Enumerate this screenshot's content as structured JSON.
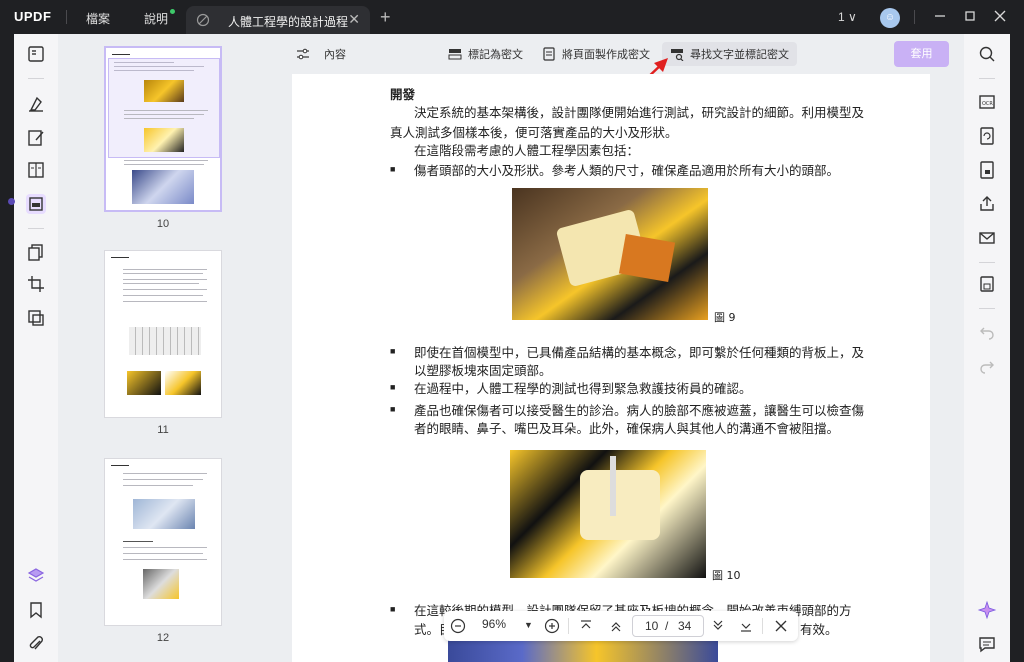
{
  "app": {
    "logo": "UPDF",
    "menu_file": "檔案",
    "menu_help": "說明",
    "tab_title": "人體工程學的設計過程",
    "page_counter": "1"
  },
  "toolbar": {
    "contents": "內容",
    "mark_as_image": "標記為密文",
    "page_to_image": "將頁面製作成密文",
    "find_and_mark": "尋找文字並標記密文",
    "apply": "套用"
  },
  "thumbnails": [
    {
      "page": "10",
      "selected": true
    },
    {
      "page": "11",
      "selected": false
    },
    {
      "page": "12",
      "selected": false
    }
  ],
  "document": {
    "heading": "開發",
    "p1_line1": "決定系統的基本架構後，設計團隊便開始進行測試，研究設計的細節。利用模型及",
    "p1_line2": "真人測試多個樣本後，便可落實產品的大小及形狀。",
    "p2": "在這階段需考慮的人體工程學因素包括：",
    "b1": "傷者頭部的大小及形狀。參考人類的尺寸，確保產品適用於所有大小的頭部。",
    "fig9": "圖 9",
    "b2_line1": "即使在首個模型中，已具備產品結構的基本概念，即可繫於任何種類的背板上，及",
    "b2_line2": "以塑膠板塊來固定頭部。",
    "b3": "在過程中，人體工程學的測試也得到緊急救護技術員的確認。",
    "b4_line1": "產品也確保傷者可以接受醫生的診治。病人的臉部不應被遮蓋，讓醫生可以檢查傷",
    "b4_line2": "者的眼睛、鼻子、嘴巴及耳朵。此外，確保病人與其他人的溝通不會被阻擋。",
    "fig10": "圖 10",
    "b5_line1": "在這較後期的模型，設計團隊保留了基座及板塊的概念，開始改善束縛頭部的方",
    "b5_line2_start": "式。目",
    "b5_line2_end": "有效。"
  },
  "zoom": {
    "value": "96%",
    "current_page": "10",
    "separator": "/",
    "total_pages": "34"
  },
  "colors": {
    "accent": "#c9b1f5",
    "titlebar": "#1f2023",
    "panel": "#eceef1",
    "brand_yellow": "#ffb800"
  }
}
